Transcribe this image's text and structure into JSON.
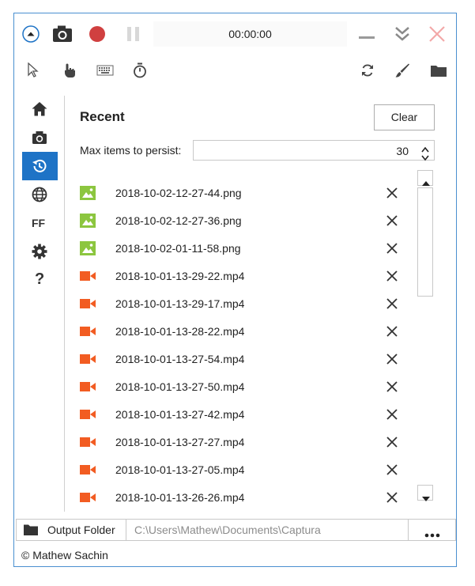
{
  "toolbar": {
    "timer": "00:00:00",
    "icons": [
      "collapse-icon",
      "camera-icon",
      "record-icon",
      "pause-icon",
      "minimize-icon",
      "double-chevron-icon",
      "close-icon"
    ]
  },
  "tools": {
    "icons": [
      "cursor-icon",
      "hand-icon",
      "keyboard-icon",
      "stopwatch-icon",
      "refresh-icon",
      "brush-icon",
      "folder-icon"
    ]
  },
  "sidebar": {
    "items": [
      {
        "name": "home",
        "icon": "home-icon"
      },
      {
        "name": "screenshot",
        "icon": "camera-icon"
      },
      {
        "name": "recent",
        "icon": "history-icon",
        "active": true
      },
      {
        "name": "language",
        "icon": "globe-icon"
      },
      {
        "name": "ffmpeg",
        "label": "FF"
      },
      {
        "name": "settings",
        "icon": "gear-icon"
      },
      {
        "name": "about",
        "label": "?"
      }
    ]
  },
  "recent": {
    "title": "Recent",
    "clear_label": "Clear",
    "max_label": "Max items to persist:",
    "max_value": "30",
    "items": [
      {
        "name": "2018-10-02-12-27-44.png",
        "type": "image"
      },
      {
        "name": "2018-10-02-12-27-36.png",
        "type": "image"
      },
      {
        "name": "2018-10-02-01-11-58.png",
        "type": "image"
      },
      {
        "name": "2018-10-01-13-29-22.mp4",
        "type": "video"
      },
      {
        "name": "2018-10-01-13-29-17.mp4",
        "type": "video"
      },
      {
        "name": "2018-10-01-13-28-22.mp4",
        "type": "video"
      },
      {
        "name": "2018-10-01-13-27-54.mp4",
        "type": "video"
      },
      {
        "name": "2018-10-01-13-27-50.mp4",
        "type": "video"
      },
      {
        "name": "2018-10-01-13-27-42.mp4",
        "type": "video"
      },
      {
        "name": "2018-10-01-13-27-27.mp4",
        "type": "video"
      },
      {
        "name": "2018-10-01-13-27-05.mp4",
        "type": "video"
      },
      {
        "name": "2018-10-01-13-26-26.mp4",
        "type": "video"
      }
    ]
  },
  "footer": {
    "output_label": "Output Folder",
    "path": "C:\\Users\\Mathew\\Documents\\Captura",
    "more_label": "•••",
    "copyright": "© Mathew Sachin"
  },
  "colors": {
    "accent": "#1e73c6",
    "record": "#d04040",
    "image_icon": "#8cc63f",
    "video_icon": "#f25c22",
    "close_x": "#f3a8a8"
  }
}
